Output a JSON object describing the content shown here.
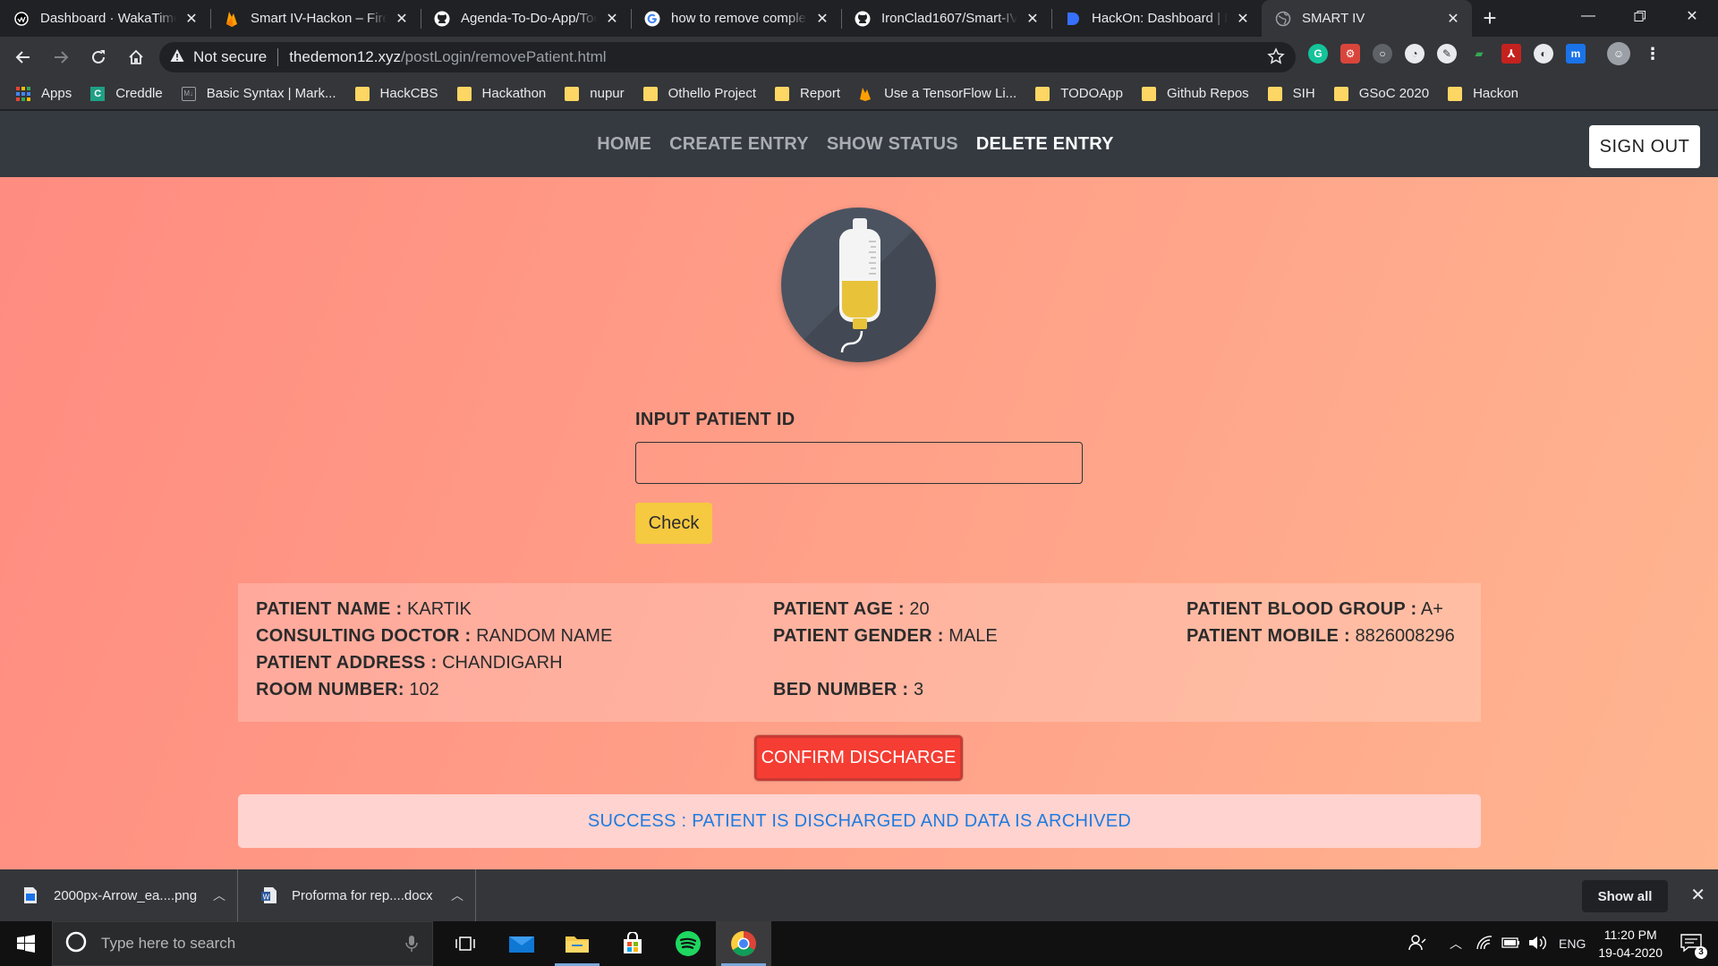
{
  "browser": {
    "tabs": [
      {
        "title": "Dashboard · WakaTime",
        "icon": "wakatime-icon"
      },
      {
        "title": "Smart IV-Hackon – Firebase",
        "icon": "firebase-icon"
      },
      {
        "title": "Agenda-To-Do-App/Todo",
        "icon": "github-icon"
      },
      {
        "title": "how to remove complete",
        "icon": "google-icon"
      },
      {
        "title": "IronClad1607/Smart-IV",
        "icon": "github-icon"
      },
      {
        "title": "HackOn: Dashboard | Devfolio",
        "icon": "devfolio-icon"
      },
      {
        "title": "SMART IV",
        "icon": "globe-icon",
        "active": true
      }
    ],
    "security_label": "Not secure",
    "url_host": "thedemon12.xyz",
    "url_path": "/postLogin/removePatient.html",
    "bookmarks": [
      {
        "label": "Apps",
        "icon": "apps-grid-icon"
      },
      {
        "label": "Creddle",
        "icon": "creddle-icon"
      },
      {
        "label": "Basic Syntax | Mark...",
        "icon": "markdown-icon"
      },
      {
        "label": "HackCBS",
        "icon": "folder-icon"
      },
      {
        "label": "Hackathon",
        "icon": "folder-icon"
      },
      {
        "label": "nupur",
        "icon": "folder-icon"
      },
      {
        "label": "Othello Project",
        "icon": "folder-icon"
      },
      {
        "label": "Report",
        "icon": "folder-icon"
      },
      {
        "label": "Use a TensorFlow Li...",
        "icon": "firebase-icon"
      },
      {
        "label": "TODOApp",
        "icon": "folder-icon"
      },
      {
        "label": "Github Repos",
        "icon": "folder-icon"
      },
      {
        "label": "SIH",
        "icon": "folder-icon"
      },
      {
        "label": "GSoC 2020",
        "icon": "folder-icon"
      },
      {
        "label": "Hackon",
        "icon": "folder-icon"
      }
    ]
  },
  "app": {
    "nav": {
      "home": "HOME",
      "create": "CREATE ENTRY",
      "status": "SHOW STATUS",
      "delete": "DELETE ENTRY",
      "signout": "SIGN OUT"
    },
    "form": {
      "label": "INPUT PATIENT ID",
      "value": "",
      "check_label": "Check"
    },
    "patient": {
      "name_label": "PATIENT NAME :",
      "name": "KARTIK",
      "age_label": "PATIENT AGE :",
      "age": "20",
      "blood_label": "PATIENT BLOOD GROUP :",
      "blood": "A+",
      "doctor_label": "CONSULTING DOCTOR :",
      "doctor": "RANDOM NAME",
      "gender_label": "PATIENT GENDER :",
      "gender": "MALE",
      "mobile_label": "PATIENT MOBILE :",
      "mobile": "8826008296",
      "address_label": "PATIENT ADDRESS :",
      "address": "CHANDIGARH",
      "room_label": "ROOM NUMBER:",
      "room": "102",
      "bed_label": "BED NUMBER :",
      "bed": "3"
    },
    "confirm_label": "CONFIRM DISCHARGE",
    "success_message": "SUCCESS : PATIENT IS DISCHARGED AND DATA IS ARCHIVED",
    "colors": {
      "navbar": "#343a40",
      "check_button": "#f5c940",
      "confirm_button": "#f53d33",
      "success_text": "#1f7be0"
    }
  },
  "downloads": {
    "items": [
      {
        "name": "2000px-Arrow_ea....png",
        "icon": "image-file-icon"
      },
      {
        "name": "Proforma for rep....docx",
        "icon": "word-file-icon"
      }
    ],
    "show_all": "Show all"
  },
  "taskbar": {
    "search_placeholder": "Type here to search",
    "language": "ENG",
    "time": "11:20 PM",
    "date": "19-04-2020",
    "notifications": "3"
  }
}
